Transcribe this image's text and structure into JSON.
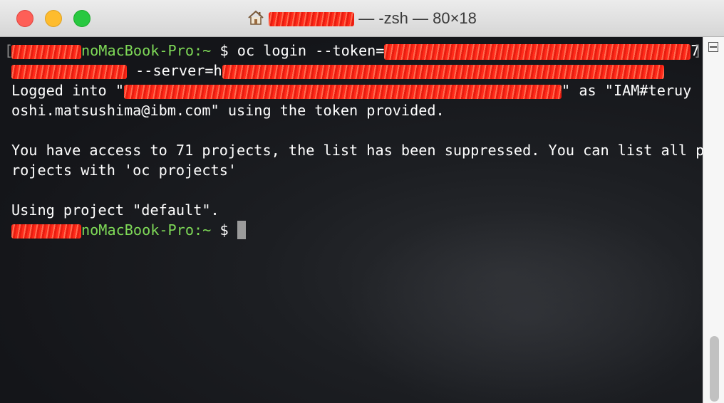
{
  "window": {
    "title_suffix": "— -zsh — 80×18"
  },
  "terminal": {
    "host_suffix": "noMacBook-Pro",
    "prompt_path": ":~",
    "prompt_symbol": " $ ",
    "bracket_open": "[",
    "bracket_close": "]",
    "cmd": "oc login --token=",
    "seven": "7",
    "server_flag": " --server=h",
    "logged_prefix": "Logged into \"",
    "logged_mid": "\" as \"IAM#teruy",
    "line_token": "oshi.matsushima@ibm.com\" using the token provided.",
    "access_1": "You have access to 71 projects, the list has been suppressed. You can list all p",
    "access_2": "rojects with 'oc projects'",
    "using": "Using project \"default\"."
  },
  "colors": {
    "prompt_green": "#7ed957",
    "redaction": "#ff2a1a",
    "text": "#ffffff"
  },
  "icons": {
    "title": "home-icon"
  }
}
